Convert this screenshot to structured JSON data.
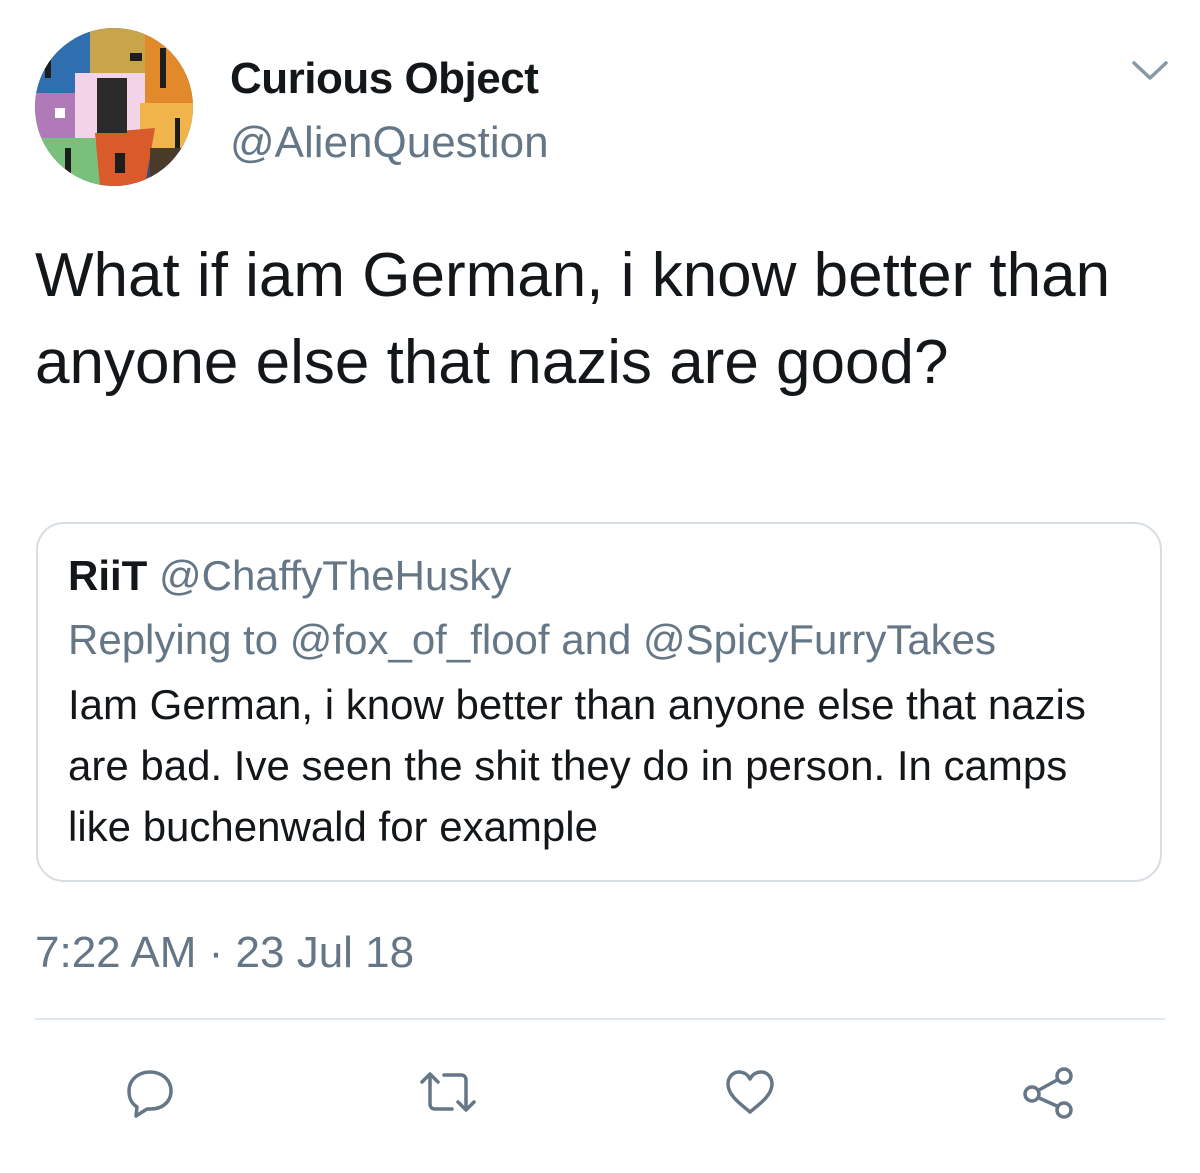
{
  "tweet": {
    "author": {
      "display_name": "Curious Object",
      "handle": "@AlienQuestion"
    },
    "text": "What if iam German, i know better than anyone else that nazis are good?",
    "quoted_tweet": {
      "author_name": "RiiT",
      "author_handle": "@ChaffyTheHusky",
      "replying_to": "Replying to @fox_of_floof and @SpicyFurryTakes",
      "text": "Iam German, i know better than anyone else that nazis are bad. Ive seen the shit they do in person. In camps like buchenwald for example"
    },
    "timestamp": "7:22 AM · 23 Jul 18"
  },
  "icons": {
    "menu": "chevron-down-icon",
    "reply": "reply-icon",
    "retweet": "retweet-icon",
    "like": "heart-icon",
    "share": "share-icon"
  },
  "colors": {
    "text_primary": "#14171a",
    "text_secondary": "#657786",
    "border": "#d6dde3",
    "icon": "#657786"
  }
}
